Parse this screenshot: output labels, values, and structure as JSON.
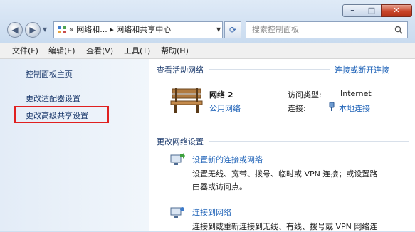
{
  "window": {
    "minimize": "–",
    "maximize": "□",
    "close": "✕"
  },
  "address": {
    "path": "« 网络和... ▸ 网络和共享中心"
  },
  "search": {
    "placeholder": "搜索控制面板"
  },
  "menu": [
    "文件(F)",
    "编辑(E)",
    "查看(V)",
    "工具(T)",
    "帮助(H)"
  ],
  "sidebar": {
    "items": [
      "控制面板主页",
      "更改适配器设置",
      "更改高级共享设置"
    ]
  },
  "active_networks": {
    "title": "查看活动网络",
    "link": "连接或断开连接",
    "network_name": "网络  2",
    "network_type": "公用网络",
    "access_label": "访问类型:",
    "access_value": "Internet",
    "connection_label": "连接:",
    "connection_value": "本地连接"
  },
  "change_settings": {
    "title": "更改网络设置",
    "items": [
      {
        "link": "设置新的连接或网络",
        "desc1": "设置无线、宽带、拨号、临时或 VPN 连接；或设置路",
        "desc2": "由器或访问点。"
      },
      {
        "link": "连接到网络",
        "desc1": "连接到或重新连接到无线、有线、拨号或 VPN 网络连"
      }
    ]
  },
  "colors": {
    "link": "#1f63b8",
    "highlight": "#e02020"
  }
}
